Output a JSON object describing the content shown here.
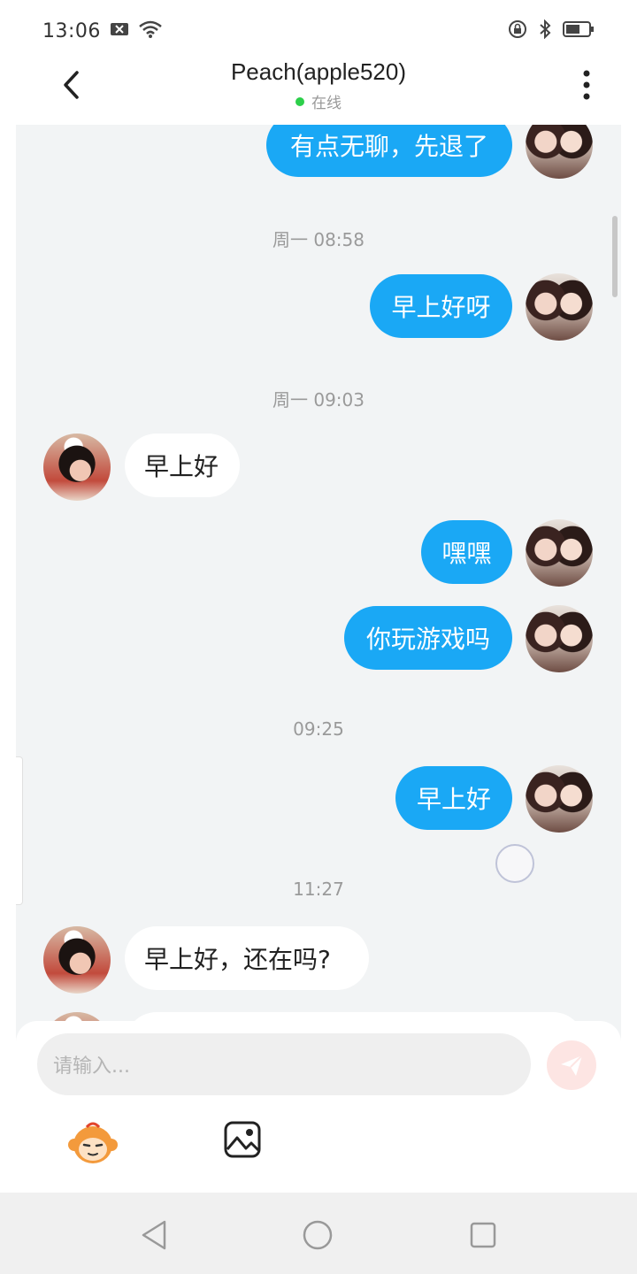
{
  "status_bar": {
    "time": "13:06",
    "icons": [
      "notification-x-icon",
      "wifi-icon",
      "rotation-lock-icon",
      "bluetooth-icon",
      "battery-icon"
    ]
  },
  "header": {
    "title": "Peach(apple520)",
    "status": "在线",
    "status_color": "#2ccf4a"
  },
  "messages": [
    {
      "sender": "me",
      "text": "有点无聊，先退了"
    },
    {
      "type": "time",
      "text": "周一 08:58"
    },
    {
      "sender": "me",
      "text": "早上好呀"
    },
    {
      "type": "time",
      "text": "周一 09:03"
    },
    {
      "sender": "them",
      "text": "早上好"
    },
    {
      "sender": "me",
      "text": "嘿嘿"
    },
    {
      "sender": "me",
      "text": "你玩游戏吗"
    },
    {
      "type": "time",
      "text": "09:25"
    },
    {
      "sender": "me",
      "text": "早上好"
    },
    {
      "type": "time",
      "text": "11:27"
    },
    {
      "sender": "them",
      "text": "早上好，还在吗?"
    }
  ],
  "composer": {
    "placeholder": "请输入..."
  },
  "colors": {
    "accent_bubble": "#1aa8f5",
    "chat_background": "#f2f4f5"
  }
}
